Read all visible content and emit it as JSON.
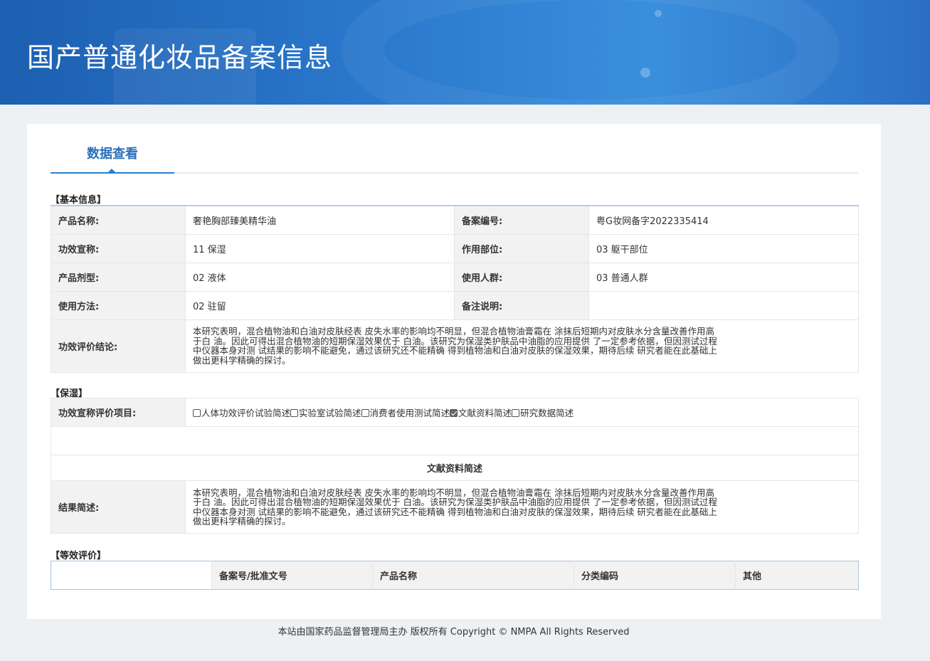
{
  "header": {
    "title": "国产普通化妆品备案信息"
  },
  "tab": {
    "label": "数据查看"
  },
  "basic": {
    "section_title": "【基本信息】",
    "product_name_label": "产品名称:",
    "product_name": "奢艳胸部臻美精华油",
    "record_no_label": "备案编号:",
    "record_no": "粤G妆网备字2022335414",
    "efficacy_label": "功效宣称:",
    "efficacy": "11 保湿",
    "site_label": "作用部位:",
    "site": "03 躯干部位",
    "form_label": "产品剂型:",
    "form": "02 液体",
    "population_label": "使用人群:",
    "population": "03 普通人群",
    "usage_label": "使用方法:",
    "usage": "02 驻留",
    "remark_label": "备注说明:",
    "remark": "",
    "conclusion_label": "功效评价结论:",
    "conclusion": "本研究表明，混合植物油和白油对皮肤经表 皮失水率的影响均不明显，但混合植物油膏霜在 涂抹后短期内对皮肤水分含量改善作用高于白 油。因此可得出混合植物油的短期保湿效果优于 白油。该研究为保湿类护肤品中油脂的应用提供 了一定参考依据，但因测试过程中仪器本身对测 试结果的影响不能避免，通过该研究还不能精确 得到植物油和白油对皮肤的保湿效果，期待后续 研究者能在此基础上做出更科学精确的探讨。"
  },
  "moist": {
    "section_title": "【保湿】",
    "items_label": "功效宣称评价项目:",
    "options": [
      {
        "label": "人体功效评价试验简述",
        "checked": false
      },
      {
        "label": "实验室试验简述",
        "checked": false
      },
      {
        "label": "消费者使用测试简述",
        "checked": false
      },
      {
        "label": "文献资料简述",
        "checked": true
      },
      {
        "label": "研究数据简述",
        "checked": false
      }
    ],
    "sub_title": "文献资料简述",
    "result_label": "结果简述:",
    "result": "本研究表明，混合植物油和白油对皮肤经表 皮失水率的影响均不明显，但混合植物油膏霜在 涂抹后短期内对皮肤水分含量改善作用高于白 油。因此可得出混合植物油的短期保湿效果优于 白油。该研究为保湿类护肤品中油脂的应用提供 了一定参考依据，但因测试过程中仪器本身对测 试结果的影响不能避免，通过该研究还不能精确 得到植物油和白油对皮肤的保湿效果，期待后续 研究者能在此基础上做出更科学精确的探讨。"
  },
  "equivalent": {
    "section_title": "【等效评价】",
    "columns": [
      "",
      "备案号/批准文号",
      "产品名称",
      "分类编码",
      "其他"
    ]
  },
  "footer": {
    "text": "本站由国家药品监督管理局主办 版权所有 Copyright © NMPA All Rights Reserved"
  }
}
